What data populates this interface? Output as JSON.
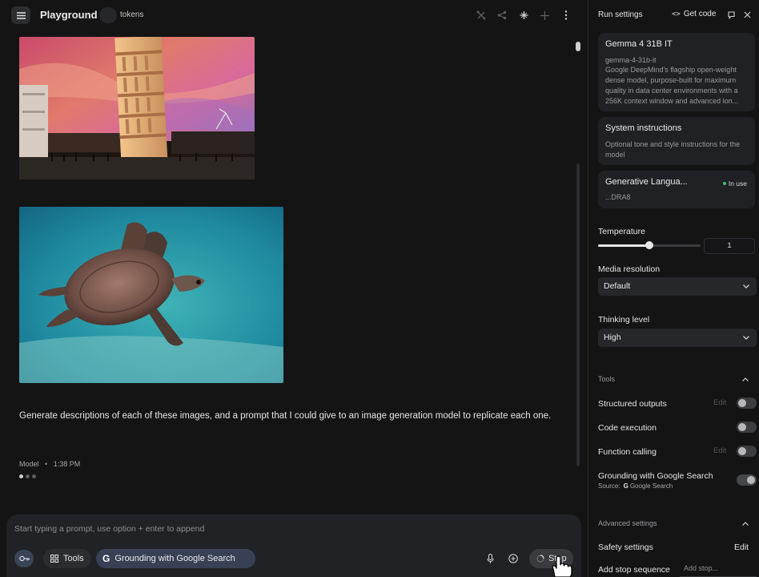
{
  "header": {
    "title": "Playground",
    "tokens_label": "tokens"
  },
  "chat": {
    "prompt": "Generate descriptions of each of these images, and a prompt that I could give to an image generation model to replicate each one.",
    "model_label": "Model",
    "timestamp": "1:38 PM"
  },
  "composer": {
    "placeholder": "Start typing a prompt, use option + enter to append",
    "tools_label": "Tools",
    "grounding_label": "Grounding with Google Search",
    "stop_label": "Stop"
  },
  "panel": {
    "title": "Run settings",
    "get_code_label": "Get code",
    "model": {
      "name": "Gemma 4 31B IT",
      "id": "gemma-4-31b-it",
      "description": "Google DeepMind's flagship open-weight dense model, purpose-built for maximum quality in data center environments with a 256K context window and advanced lon..."
    },
    "system_instructions": {
      "title": "System instructions",
      "placeholder": "Optional tone and style instructions for the model"
    },
    "api_key": {
      "name": "Generative Langua...",
      "status": "In use",
      "suffix": "...DRA8"
    },
    "temperature": {
      "label": "Temperature",
      "value": "1",
      "level": 0.5
    },
    "media_resolution": {
      "label": "Media resolution",
      "selected": "Default"
    },
    "thinking_level": {
      "label": "Thinking level",
      "selected": "High"
    },
    "tools": {
      "header": "Tools",
      "items": [
        {
          "label": "Structured outputs",
          "edit": "Edit",
          "on": false
        },
        {
          "label": "Code execution",
          "edit": "",
          "on": false
        },
        {
          "label": "Function calling",
          "edit": "Edit",
          "on": false
        },
        {
          "label": "Grounding with Google Search",
          "edit": "",
          "on": true
        }
      ],
      "source_prefix": "Source:",
      "source_name": "Google Search"
    },
    "advanced": {
      "header": "Advanced settings",
      "safety_label": "Safety settings",
      "safety_edit": "Edit",
      "stop_sequence_label": "Add stop sequence",
      "stop_sequence_placeholder": "Add stop..."
    }
  },
  "colors": {
    "background": "#141415",
    "card": "#202124",
    "chip_active": "#374055",
    "in_use_dot": "#35c46b"
  }
}
